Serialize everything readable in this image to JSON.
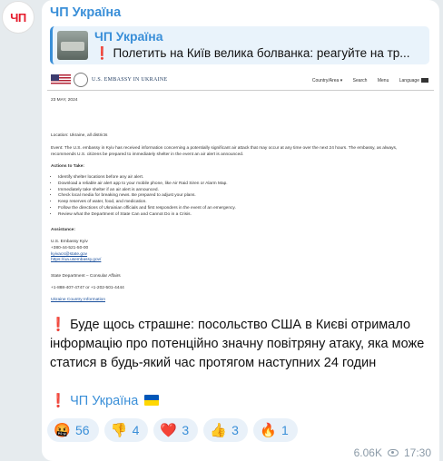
{
  "channel": {
    "avatar_text": "ЧП",
    "name": "ЧП Україна"
  },
  "reply": {
    "name": "ЧП Україна",
    "text": "❗ Полетить на Київ велика болванка: реагуйте на тр..."
  },
  "document": {
    "embassy_name": "U.S. EMBASSY IN UKRAINE",
    "nav": {
      "country": "Country/Area ▾",
      "search": "Search",
      "menu": "Menu",
      "language": "Language"
    },
    "date": "23 MAY, 2024",
    "location": "Location: Ukraine, all districts",
    "event": "Event: The U.S. embassy in Kyiv has received information concerning a potentially significant air attack that may occur at any time over the next 24 hours. The embassy, as always, recommends U.S. citizens be prepared to immediately shelter in the event an air alert is announced.",
    "actions_title": "Actions to Take:",
    "actions": [
      "Identify shelter locations before any air alert.",
      "Download a reliable air alert app to your mobile phone, like Air Raid Siren or Alarm Map.",
      "Immediately take shelter if an air alert is announced.",
      "Check local media for breaking news. Be prepared to adjust your plans.",
      "Keep reserves of water, food, and medication.",
      "Follow the directions of Ukrainian officials and first responders in the event of an emergency.",
      "Review what the Department of State Can and Cannot Do in a Crisis."
    ],
    "assistance_title": "Assistance:",
    "assistance": [
      "U.S. Embassy Kyiv",
      "+380-44-521-50-00",
      "kyivacs@state.gov",
      "https://ua.usembassy.gov/"
    ],
    "state_dept": [
      "State Department – Consular Affairs",
      "+1-888-407-4747 or +1-202-501-4444"
    ],
    "country_info": "Ukraine Country Information"
  },
  "caption": "❗ Буде щось страшне: посольство США в Києві отримало інформацію про потенційно значну повітряну атаку, яка може статися в будь-який час протягом наступних 24 годин",
  "signature": {
    "mark": "❗",
    "name": "ЧП Україна"
  },
  "reactions": [
    {
      "emoji": "🤬",
      "count": "56"
    },
    {
      "emoji": "👎",
      "count": "4"
    },
    {
      "emoji": "❤️",
      "count": "3"
    },
    {
      "emoji": "👍",
      "count": "3"
    },
    {
      "emoji": "🔥",
      "count": "1"
    }
  ],
  "meta": {
    "views": "6.06K",
    "time": "17:30"
  },
  "colors": {
    "accent": "#3a8fd8",
    "background": "#e6ebee",
    "reaction_bg": "#e9f1f9",
    "avatar_text": "#e5192a"
  }
}
